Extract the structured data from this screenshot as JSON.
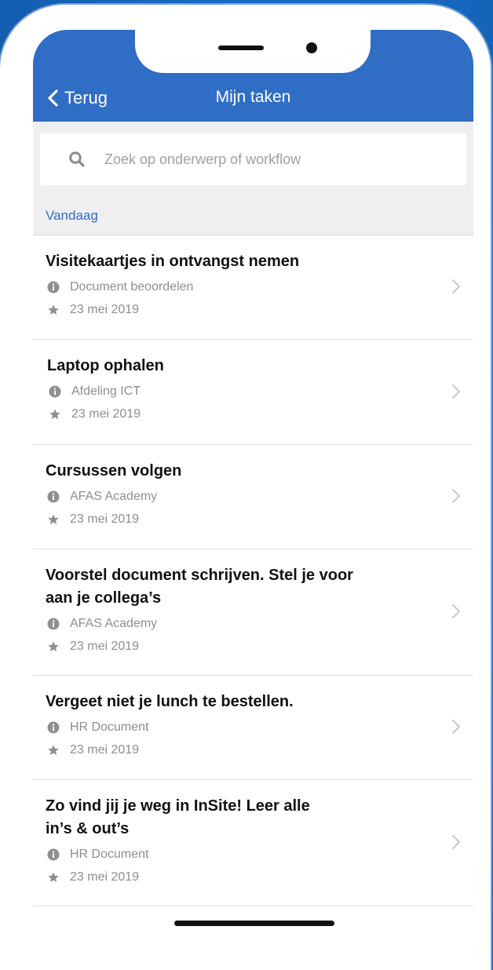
{
  "header": {
    "back_label": "Terug",
    "title": "Mijn taken"
  },
  "search": {
    "placeholder": "Zoek op onderwerp of workflow"
  },
  "section": {
    "label": "Vandaag"
  },
  "tasks": [
    {
      "title_lines": [
        "Visitekaartjes in ontvangst nemen"
      ],
      "category": "Document beoordelen",
      "date": "23 mei 2019"
    },
    {
      "title_lines": [
        "Laptop ophalen"
      ],
      "category": "Afdeling ICT",
      "date": "23 mei 2019"
    },
    {
      "title_lines": [
        "Cursussen volgen"
      ],
      "category": "AFAS Academy",
      "date": "23 mei 2019"
    },
    {
      "title_lines": [
        "Voorstel document schrijven. Stel je voor",
        "aan je collega’s"
      ],
      "category": "AFAS Academy",
      "date": "23 mei 2019"
    },
    {
      "title_lines": [
        "Vergeet niet je lunch te bestellen."
      ],
      "category": "HR Document",
      "date": "23 mei 2019"
    },
    {
      "title_lines": [
        "Zo vind jij je weg in InSite! Leer alle",
        "in’s & out’s"
      ],
      "category": "HR Document",
      "date": "23 mei 2019"
    }
  ],
  "icons": {
    "back": "chevron-left-icon",
    "search": "search-icon",
    "category": "info-icon",
    "date": "star-icon",
    "open": "chevron-right-icon"
  },
  "colors": {
    "accent": "#2f6ec4",
    "background": "#176bc4"
  }
}
